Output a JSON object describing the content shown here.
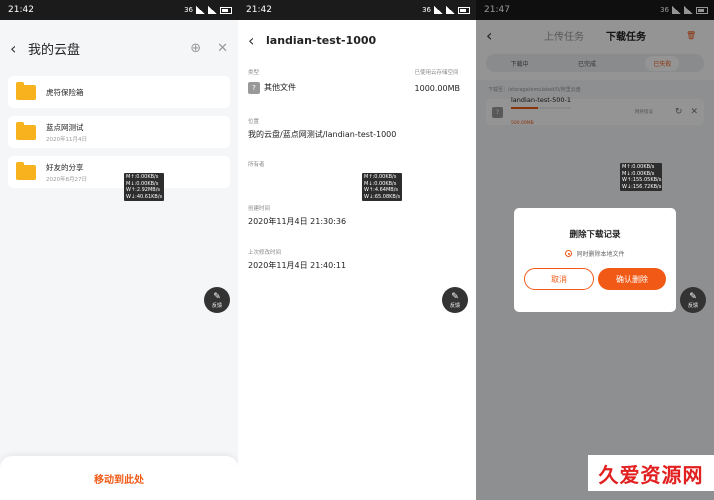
{
  "screen1": {
    "status": {
      "time": "21:42",
      "indicator": "36"
    },
    "title": "我的云盘",
    "folders": [
      {
        "name": "虎符保险箱",
        "date": ""
      },
      {
        "name": "蓝点网测试",
        "date": "2020年11月4日"
      },
      {
        "name": "好友的分享",
        "date": "2020年8月27日"
      }
    ],
    "speed": [
      "M↑:0.00KB/s",
      "M↓:0.00KB/s",
      "W↑:2.92MB/s",
      "W↓:40.61KB/s"
    ],
    "fab_label": "反馈",
    "move_here": "移动到此处"
  },
  "screen2": {
    "status": {
      "time": "21:42",
      "indicator": "36"
    },
    "title": "landian-test-1000",
    "type_label": "类型",
    "type_value": "其他文件",
    "used_label": "已使用云存储空间",
    "used_value": "1000.00MB",
    "location_label": "位置",
    "location_value": "我的云盘/蓝点网测试/landian-test-1000",
    "owner_label": "所有者",
    "created_label": "创建时间",
    "created_value": "2020年11月4日 21:30:36",
    "modified_label": "上次修改时间",
    "modified_value": "2020年11月4日 21:40:11",
    "speed": [
      "M↑:0.00KB/s",
      "M↓:0.00KB/s",
      "W↑:4.64MB/s",
      "W↓:65.08KB/s"
    ],
    "fab_label": "反馈"
  },
  "screen3": {
    "status": {
      "time": "21:47",
      "indicator": "36"
    },
    "tabs": [
      "上传任务",
      "下载任务"
    ],
    "active_tab": 1,
    "segments": [
      "下载中",
      "已完成",
      "已失败"
    ],
    "active_segment": 2,
    "path": "下载至：/storage/emulated/0/阿里云盘",
    "task": {
      "name": "landian-test-500-1",
      "size": "500.00MB",
      "status": "网络错误",
      "progress": 0.45
    },
    "speed": [
      "M↑:0.00KB/s",
      "M↓:0.00KB/s",
      "W↑:155.05KB/s",
      "W↓:156.72KB/s"
    ],
    "dialog": {
      "title": "删除下载记录",
      "checkbox": "同时删除本地文件",
      "cancel": "取消",
      "confirm": "确认删除"
    },
    "fab_label": "反馈"
  },
  "watermark": "久爱资源网",
  "colors": {
    "accent": "#f05a16",
    "folder": "#f7b21d"
  }
}
